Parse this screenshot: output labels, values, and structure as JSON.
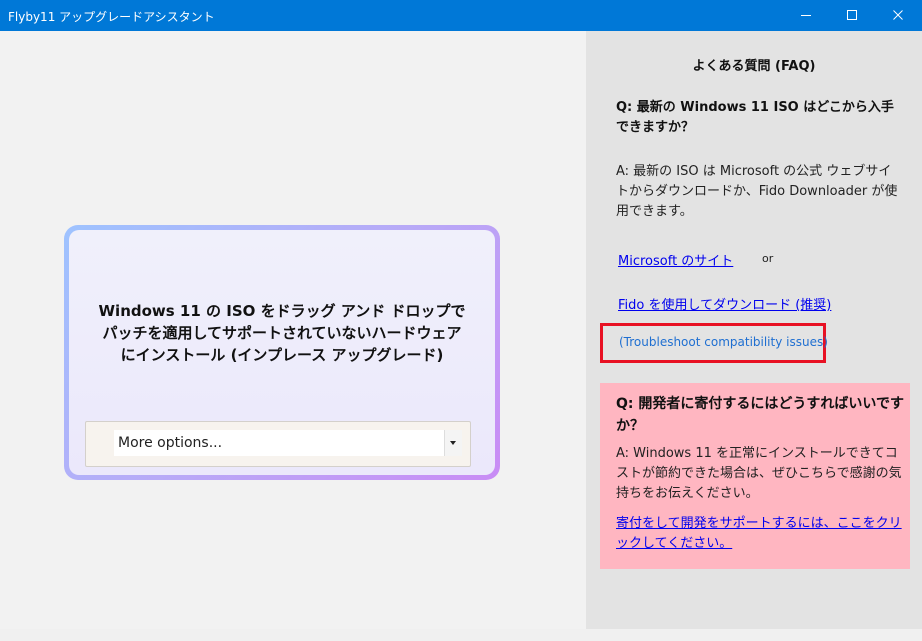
{
  "window": {
    "title": "Flyby11 アップグレードアシスタント"
  },
  "drop_zone": {
    "lines": [
      "Windows 11 の ISO をドラッグ アンド ドロップで",
      "パッチを適用してサポートされていないハードウェア",
      "にインストール (インプレース アップグレード)"
    ],
    "options_selected": "More options..."
  },
  "faq": {
    "title": "よくある質問 (FAQ)",
    "q1": "Q: 最新の Windows 11 ISO はどこから入手できますか？",
    "a1": "A: 最新の ISO は Microsoft の公式 ウェブサイトからダウンロードか、Fido Downloader が使用できます。",
    "link_microsoft": "Microsoft のサイト",
    "or": "or",
    "link_fido": "Fido を使用してダウンロード (推奨)",
    "troubleshoot": "(Troubleshoot compatibility issues)"
  },
  "donate": {
    "question": "Q:  開発者に寄付するにはどうすればいいですか？",
    "answer": "A: Windows 11 を正常にインストールできてコストが節約できた場合は、ぜひこちらで感謝の気持ちをお伝えください。",
    "link": "寄付をして開発をサポートするには、ここをクリックしてください。"
  },
  "colors": {
    "titlebar": "#0078d7",
    "highlight_border": "#e81123",
    "donate_bg": "#ffb6c1",
    "link": "#0000ee"
  },
  "icons": {
    "minimize": "minimize-icon",
    "maximize": "maximize-icon",
    "close": "close-icon",
    "dropdown": "chevron-down-icon"
  }
}
